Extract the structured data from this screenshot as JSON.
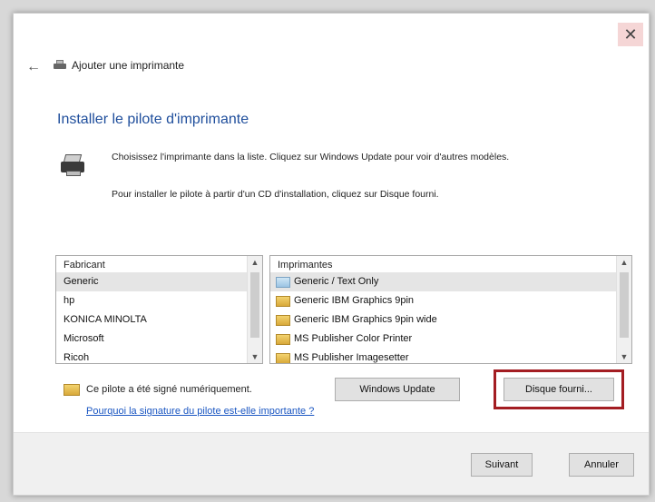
{
  "window": {
    "header_title": "Ajouter une imprimante",
    "close_glyph": "✕",
    "back_glyph": "←"
  },
  "main": {
    "title": "Installer le pilote d'imprimante",
    "description_line1": "Choisissez l'imprimante dans la liste. Cliquez sur Windows Update pour voir d'autres modèles.",
    "description_line2": "Pour installer le pilote à partir d'un CD d'installation, cliquez sur Disque fourni."
  },
  "manufacturers": {
    "header": "Fabricant",
    "items": [
      "Generic",
      "hp",
      "KONICA MINOLTA",
      "Microsoft",
      "Ricoh"
    ],
    "selected_index": 0
  },
  "printers": {
    "header": "Imprimantes",
    "items": [
      "Generic / Text Only",
      "Generic IBM Graphics 9pin",
      "Generic IBM Graphics 9pin wide",
      "MS Publisher Color Printer",
      "MS Publisher Imagesetter"
    ],
    "selected_index": 0
  },
  "signature": {
    "text": "Ce pilote a été signé numériquement.",
    "link": "Pourquoi la signature du pilote est-elle importante ?"
  },
  "buttons": {
    "windows_update": "Windows Update",
    "have_disk": "Disque fourni...",
    "next": "Suivant",
    "cancel": "Annuler"
  },
  "colors": {
    "title_blue": "#1f4e9c",
    "link_blue": "#1a56c2",
    "highlight_red": "#a31d22"
  }
}
